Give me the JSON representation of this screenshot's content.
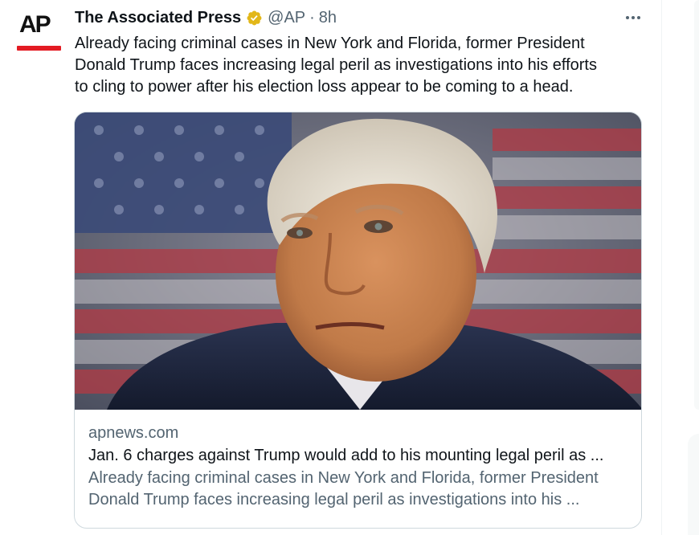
{
  "tweet": {
    "author": {
      "name": "The Associated Press",
      "handle": "@AP",
      "separator": "·",
      "time": "8h",
      "avatar_text": "AP",
      "verified_color": "#e2b719"
    },
    "text_lines": [
      "Already facing criminal cases in New York and Florida, former President",
      "Donald Trump faces increasing legal peril as investigations into his efforts",
      "to cling to power after his election loss appear to be coming to a head."
    ],
    "card": {
      "domain": "apnews.com",
      "headline": "Jan. 6 charges against Trump would add to his mounting legal peril as ...",
      "description_lines": [
        "Already facing criminal cases in New York and Florida, former President",
        "Donald Trump faces increasing legal peril as investigations into his ..."
      ]
    }
  },
  "colors": {
    "text_primary": "#0f1419",
    "text_secondary": "#536471",
    "card_border": "#cfd9de",
    "ap_red": "#e31b23"
  },
  "icons": {
    "more": "more-horizontal-icon",
    "verified": "verified-badge-icon"
  }
}
